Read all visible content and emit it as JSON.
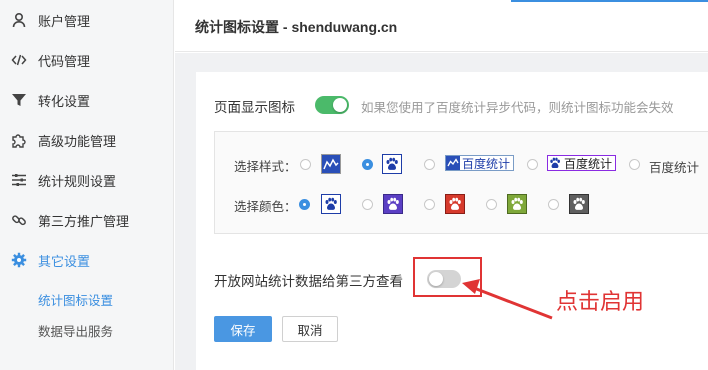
{
  "sidebar": {
    "items": [
      {
        "label": "账户管理",
        "icon": "user-icon"
      },
      {
        "label": "代码管理",
        "icon": "code-icon"
      },
      {
        "label": "转化设置",
        "icon": "funnel-icon"
      },
      {
        "label": "高级功能管理",
        "icon": "puzzle-icon"
      },
      {
        "label": "统计规则设置",
        "icon": "sliders-icon"
      },
      {
        "label": "第三方推广管理",
        "icon": "link-icon"
      },
      {
        "label": "其它设置",
        "icon": "gear-icon",
        "active": true
      }
    ],
    "subitems": [
      {
        "label": "统计图标设置",
        "active": true
      },
      {
        "label": "数据导出服务"
      }
    ]
  },
  "header": {
    "title": "统计图标设置 - shenduwang.cn"
  },
  "settings": {
    "show_icon_label": "页面显示图标",
    "show_icon_enabled": true,
    "hint": "如果您使用了百度统计异步代码，则统计图标功能会失效",
    "style_label": "选择样式：",
    "style_options": [
      "百度统计",
      "百度统计",
      "百度统计"
    ],
    "selected_style_index": 1,
    "color_label": "选择颜色：",
    "color_options": [
      "#1e3da8",
      "#5b3fc4",
      "#d63a2c",
      "#7fa83a",
      "#5f5f5f"
    ],
    "selected_color_index": 0,
    "share_label": "开放网站统计数据给第三方查看",
    "share_enabled": false
  },
  "annotation": {
    "text": "点击启用",
    "color": "#e03434"
  },
  "buttons": {
    "save": "保存",
    "cancel": "取消"
  },
  "colors": {
    "accent": "#3b8fe0",
    "toggle_on": "#4bba6a",
    "annotation": "#e03434"
  }
}
